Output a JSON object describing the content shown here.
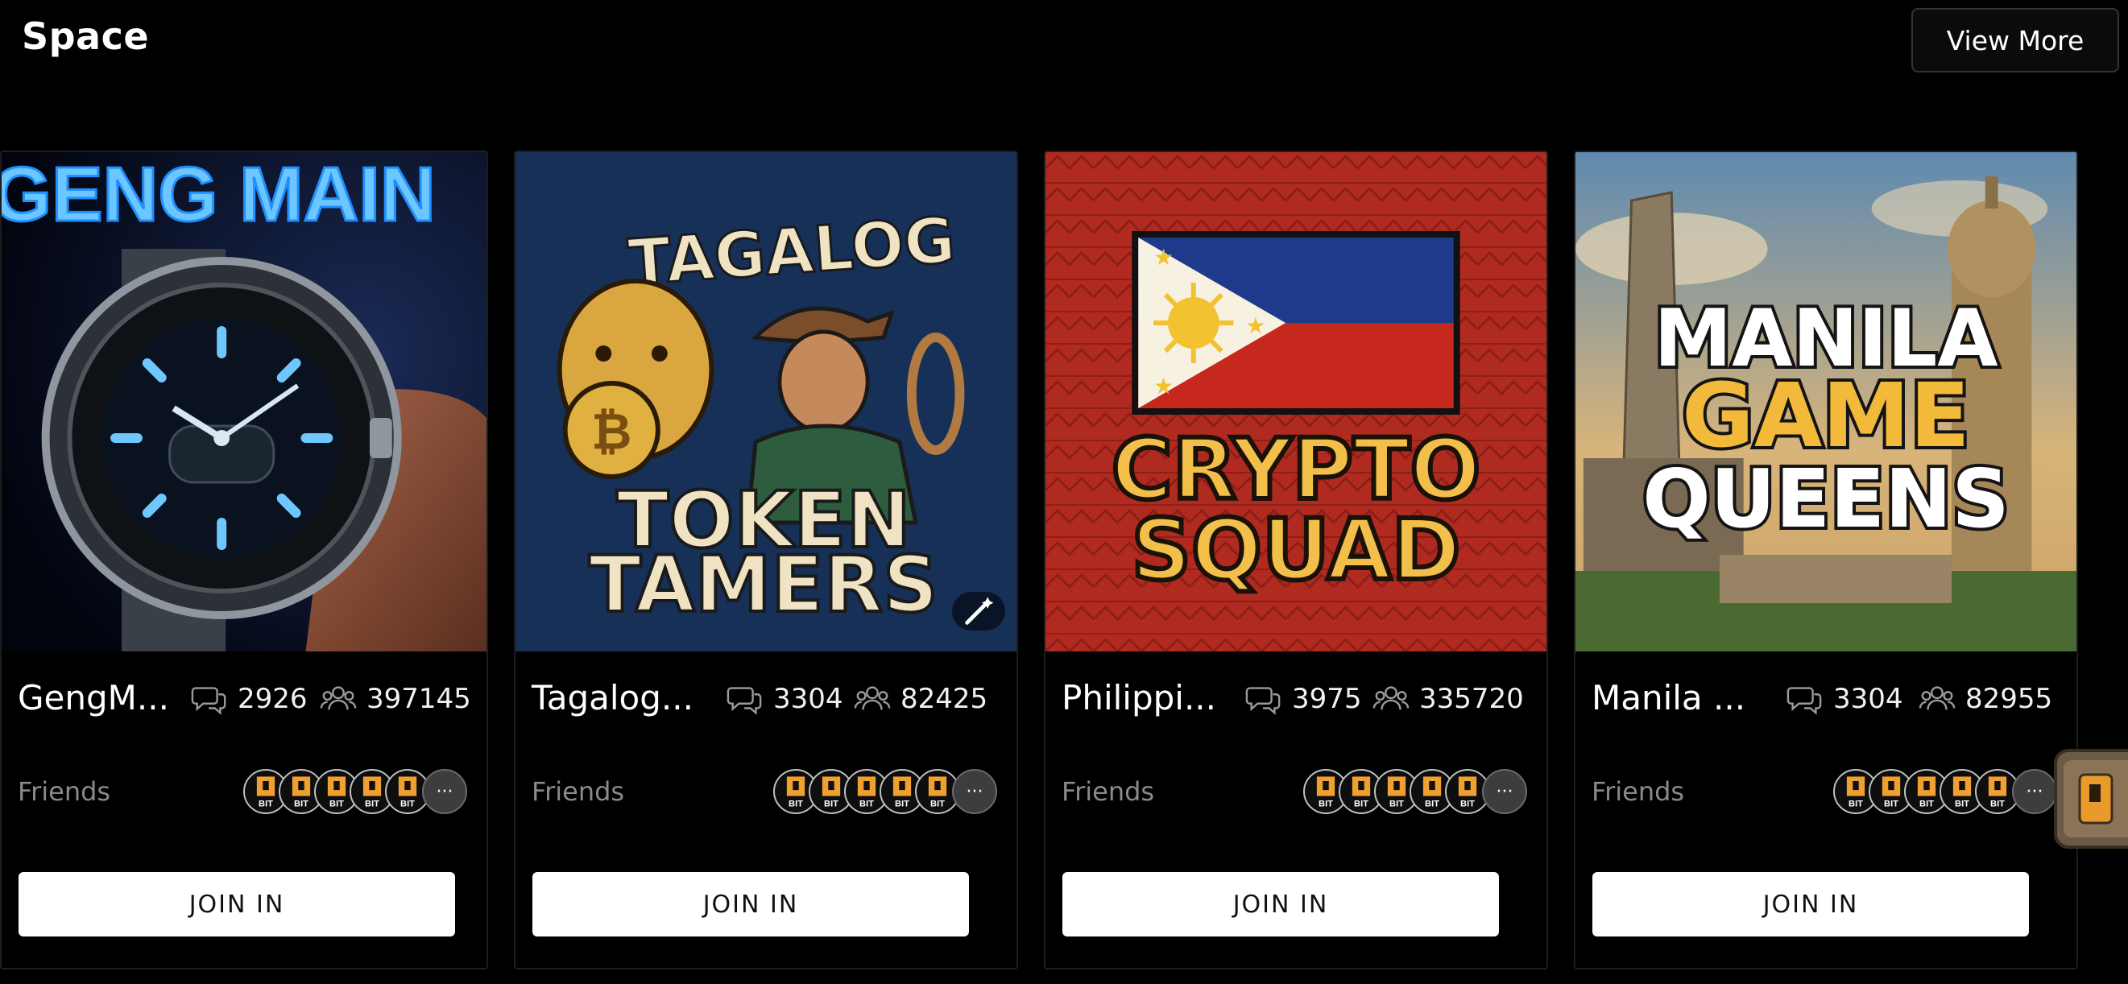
{
  "section": {
    "title": "Space",
    "view_more_label": "View More"
  },
  "cards": [
    {
      "name": "GengM...",
      "comments": "2926",
      "members": "397145",
      "friends_label": "Friends",
      "more_label": "···",
      "join_label": "JOIN IN",
      "image_text": [
        "GENG MAIN"
      ]
    },
    {
      "name": "Tagalog...",
      "comments": "3304",
      "members": "82425",
      "friends_label": "Friends",
      "more_label": "···",
      "join_label": "JOIN IN",
      "image_text": [
        "TAGALOG",
        "TOKEN",
        "TAMERS"
      ]
    },
    {
      "name": "Philippi...",
      "comments": "3975",
      "members": "335720",
      "friends_label": "Friends",
      "more_label": "···",
      "join_label": "JOIN IN",
      "image_text": [
        "CRYPTO",
        "SQUAD"
      ]
    },
    {
      "name": "Manila ...",
      "comments": "3304",
      "members": "82955",
      "friends_label": "Friends",
      "more_label": "···",
      "join_label": "JOIN IN",
      "image_text": [
        "MANILA",
        "GAME",
        "QUEENS"
      ]
    }
  ],
  "avatar_text": "BIT",
  "icons": {
    "comments": "chat-bubbles-icon",
    "members": "people-icon",
    "badge": "magic-wand-icon"
  },
  "colors": {
    "background": "#000000",
    "button_bg": "#ffffff",
    "muted_text": "#8a8a8a",
    "avatar_orange": "#f0a030"
  }
}
